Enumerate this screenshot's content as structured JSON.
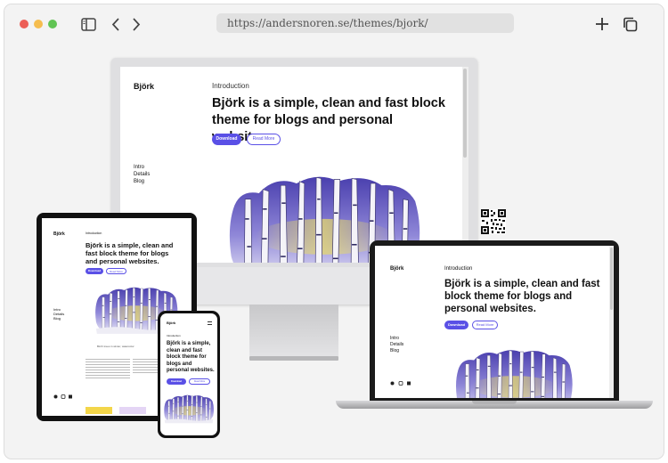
{
  "browser": {
    "url": "https://andersnoren.se/themes/bjork/",
    "icons": [
      "sidebar-icon",
      "chevron-left-icon",
      "chevron-right-icon",
      "plus-icon",
      "tabs-icon"
    ]
  },
  "colors": {
    "accent": "#5a50e6",
    "traffic": [
      "#ec5f57",
      "#f5bd4f",
      "#61c454"
    ]
  },
  "site": {
    "logo": "Björk",
    "label": "Introduction",
    "headline": "Björk is a simple, clean and fast block theme for blogs and personal websites.",
    "download": "Download",
    "read_more": "Read More",
    "nav": [
      "Intro",
      "Details",
      "Blog"
    ],
    "tablet_caption": "Birch trees in winter, watercolor",
    "phone_label": "Introduction"
  },
  "qr_code": {
    "label": "qr-code"
  }
}
